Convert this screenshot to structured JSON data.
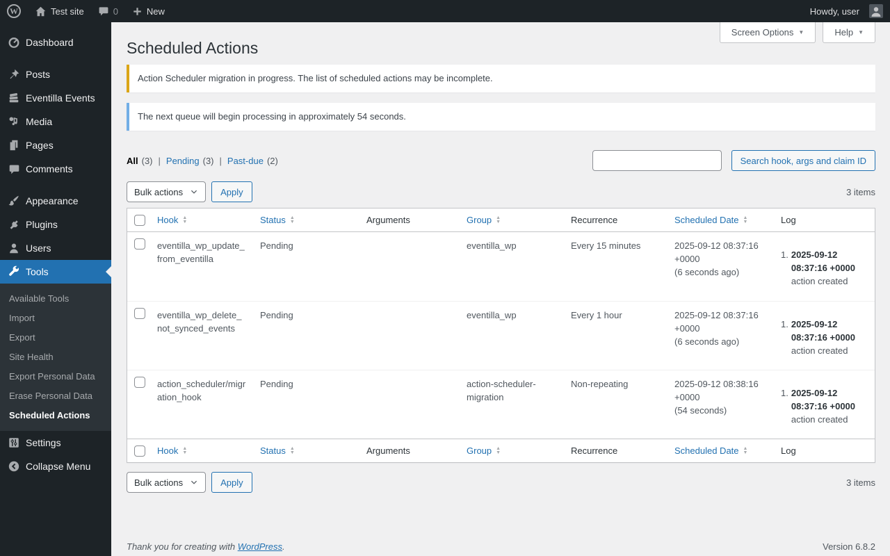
{
  "colors": {
    "accent_blue": "#2271b1",
    "admin_bar_bg": "#1d2327",
    "submenu_bg": "#2c3338",
    "content_bg": "#f0f0f1",
    "notice_warning_border": "#dba617",
    "notice_info_border": "#72aee6",
    "table_border": "#c3c4c7"
  },
  "icons": {
    "wordpress_logo": "W",
    "dropdown_arrow": "▼",
    "sort_asc": "▲",
    "sort_desc": "▼"
  },
  "admin_bar": {
    "site_name": "Test site",
    "comments_count": "0",
    "new_label": "New",
    "howdy": "Howdy, user"
  },
  "sidebar": {
    "items": [
      {
        "label": "Dashboard"
      },
      {
        "label": "Posts"
      },
      {
        "label": "Eventilla Events"
      },
      {
        "label": "Media"
      },
      {
        "label": "Pages"
      },
      {
        "label": "Comments"
      },
      {
        "label": "Appearance"
      },
      {
        "label": "Plugins"
      },
      {
        "label": "Users"
      },
      {
        "label": "Tools"
      },
      {
        "label": "Settings"
      },
      {
        "label": "Collapse Menu"
      }
    ],
    "tools_submenu": [
      {
        "label": "Available Tools"
      },
      {
        "label": "Import"
      },
      {
        "label": "Export"
      },
      {
        "label": "Site Health"
      },
      {
        "label": "Export Personal Data"
      },
      {
        "label": "Erase Personal Data"
      },
      {
        "label": "Scheduled Actions"
      }
    ]
  },
  "page": {
    "title": "Scheduled Actions",
    "screen_options_label": "Screen Options",
    "help_label": "Help"
  },
  "notices": {
    "migration": "Action Scheduler migration in progress. The list of scheduled actions may be incomplete.",
    "queue": "The next queue will begin processing in approximately 54 seconds."
  },
  "filters": {
    "separator": "|",
    "items": [
      {
        "label": "All",
        "count": "(3)"
      },
      {
        "label": "Pending",
        "count": "(3)"
      },
      {
        "label": "Past-due",
        "count": "(2)"
      }
    ]
  },
  "search": {
    "value": "",
    "button_label": "Search hook, args and claim ID"
  },
  "tablenav": {
    "bulk_actions_label": "Bulk actions",
    "apply_label": "Apply",
    "items_count": "3 items"
  },
  "table": {
    "columns": {
      "hook": "Hook",
      "status": "Status",
      "arguments": "Arguments",
      "group": "Group",
      "recurrence": "Recurrence",
      "scheduled_date": "Scheduled Date",
      "log": "Log"
    },
    "rows": [
      {
        "hook": "eventilla_wp_update_from_eventilla",
        "status": "Pending",
        "arguments": "",
        "group": "eventilla_wp",
        "recurrence": "Every 15 minutes",
        "scheduled_date": "2025-09-12 08:37:16 +0000",
        "scheduled_relative": "(6 seconds ago)",
        "log_index": "1.",
        "log_date": "2025-09-12 08:37:16 +0000",
        "log_message": "action created"
      },
      {
        "hook": "eventilla_wp_delete_not_synced_events",
        "status": "Pending",
        "arguments": "",
        "group": "eventilla_wp",
        "recurrence": "Every 1 hour",
        "scheduled_date": "2025-09-12 08:37:16 +0000",
        "scheduled_relative": "(6 seconds ago)",
        "log_index": "1.",
        "log_date": "2025-09-12 08:37:16 +0000",
        "log_message": "action created"
      },
      {
        "hook": "action_scheduler/migration_hook",
        "status": "Pending",
        "arguments": "",
        "group": "action-scheduler-migration",
        "recurrence": "Non-repeating",
        "scheduled_date": "2025-09-12 08:38:16 +0000",
        "scheduled_relative": "(54 seconds)",
        "log_index": "1.",
        "log_date": "2025-09-12 08:37:16 +0000",
        "log_message": "action created"
      }
    ]
  },
  "footer": {
    "thanks_prefix": "Thank you for creating with ",
    "wordpress_link": "WordPress",
    "period": ".",
    "version": "Version 6.8.2"
  }
}
